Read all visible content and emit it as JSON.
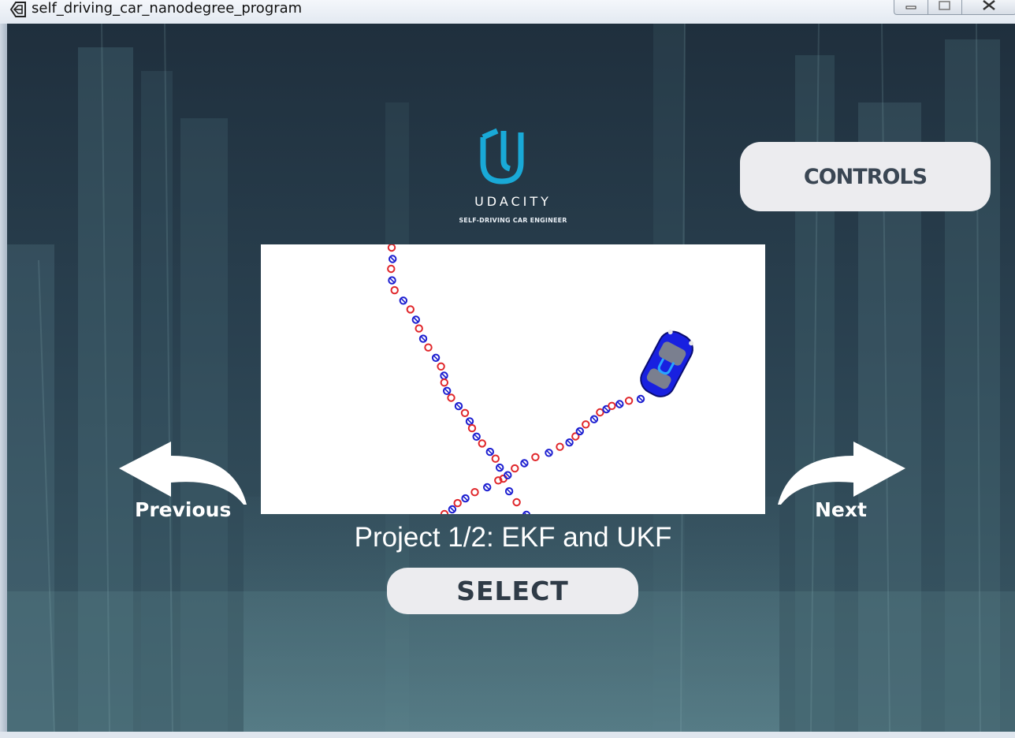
{
  "window": {
    "title": "self_driving_car_nanodegree_program",
    "controls": [
      "minimize",
      "maximize",
      "close"
    ]
  },
  "icons": {
    "app": "unity-icon",
    "logo": "udacity-u-logo-icon",
    "previous": "curved-arrow-left-icon",
    "next": "curved-arrow-right-icon",
    "car": "car-icon"
  },
  "brand": {
    "name": "UDACITY",
    "tagline": "SELF-DRIVING CAR ENGINEER"
  },
  "menu": {
    "controls_label": "CONTROLS",
    "previous_label": "Previous",
    "next_label": "Next",
    "project_title": "Project 1/2: EKF and UKF",
    "select_label": "SELECT"
  },
  "colors": {
    "logo_accent": "#19a9d7",
    "button_bg": "#ececef",
    "button_text": "#3a4653",
    "background": "#2a3d4a",
    "measurement_red": "#e0262a",
    "estimate_blue": "#1d1fd0",
    "car_blue": "#1820e0"
  }
}
